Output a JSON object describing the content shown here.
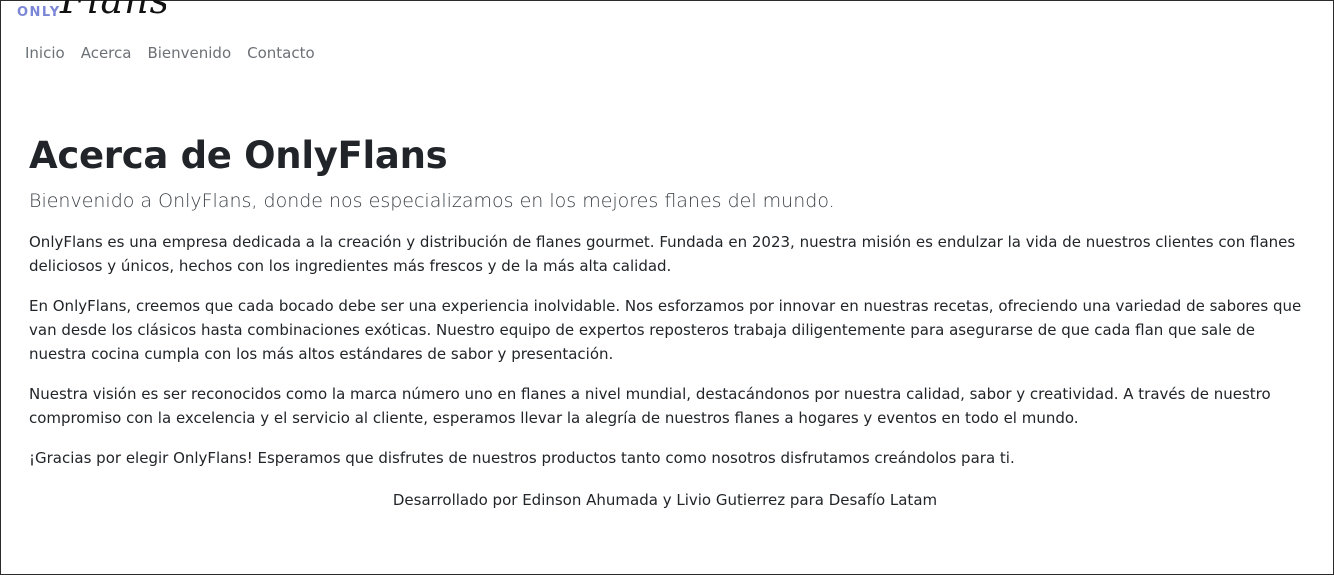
{
  "brand": {
    "only": "ONLY",
    "flans": "Flans"
  },
  "nav": {
    "items": [
      {
        "label": "Inicio"
      },
      {
        "label": "Acerca"
      },
      {
        "label": "Bienvenido"
      },
      {
        "label": "Contacto"
      }
    ]
  },
  "main": {
    "title": "Acerca de OnlyFlans",
    "lead": "Bienvenido a OnlyFlans, donde nos especializamos en los mejores flanes del mundo.",
    "paragraphs": [
      "OnlyFlans es una empresa dedicada a la creación y distribución de flanes gourmet. Fundada en 2023, nuestra misión es endulzar la vida de nuestros clientes con flanes deliciosos y únicos, hechos con los ingredientes más frescos y de la más alta calidad.",
      "En OnlyFlans, creemos que cada bocado debe ser una experiencia inolvidable. Nos esforzamos por innovar en nuestras recetas, ofreciendo una variedad de sabores que van desde los clásicos hasta combinaciones exóticas. Nuestro equipo de expertos reposteros trabaja diligentemente para asegurarse de que cada flan que sale de nuestra cocina cumpla con los más altos estándares de sabor y presentación.",
      "Nuestra visión es ser reconocidos como la marca número uno en flanes a nivel mundial, destacándonos por nuestra calidad, sabor y creatividad. A través de nuestro compromiso con la excelencia y el servicio al cliente, esperamos llevar la alegría de nuestros flanes a hogares y eventos en todo el mundo.",
      "¡Gracias por elegir OnlyFlans! Esperamos que disfrutes de nuestros productos tanto como nosotros disfrutamos creándolos para ti."
    ]
  },
  "footer": {
    "credit": "Desarrollado por Edinson Ahumada y Livio Gutierrez para Desafío Latam"
  },
  "colors": {
    "nav_text": "#6c7177",
    "brand_accent": "#7b86d6",
    "body_text": "#212529"
  }
}
